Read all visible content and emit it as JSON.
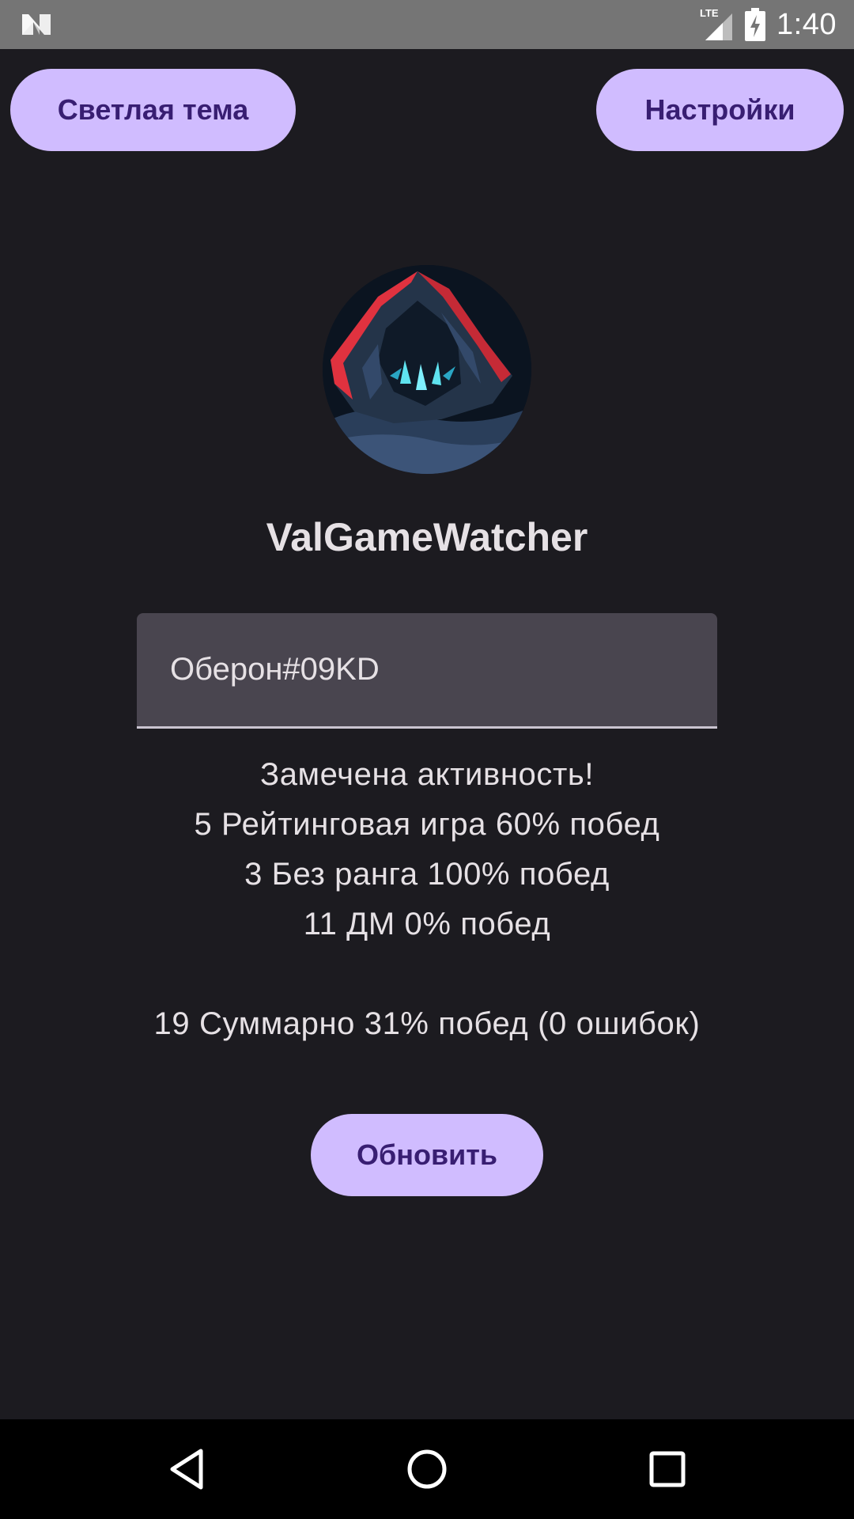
{
  "status_bar": {
    "time": "1:40",
    "network_label": "LTE",
    "icons": [
      "notification-n-icon",
      "lte-signal-icon",
      "battery-charging-icon"
    ]
  },
  "header": {
    "theme_button_label": "Светлая тема",
    "settings_button_label": "Настройки"
  },
  "app": {
    "title": "ValGameWatcher"
  },
  "player_field": {
    "value": "Оберон#09KD"
  },
  "stats": {
    "activity": "Замечена активность!",
    "ranked": "5 Рейтинговая игра 60% побед",
    "unrated": "3 Без ранга 100% побед",
    "deathmatch": "11 ДМ 0% побед",
    "total": "19 Суммарно 31% побед (0 ошибок)"
  },
  "actions": {
    "refresh_label": "Обновить"
  },
  "nav": {
    "icons": [
      "back-icon",
      "home-icon",
      "recents-icon"
    ]
  },
  "colors": {
    "background": "#1c1b20",
    "button": "#d0bcff",
    "button_text": "#381e72",
    "field": "#49454f",
    "text": "#e6e1e5"
  }
}
